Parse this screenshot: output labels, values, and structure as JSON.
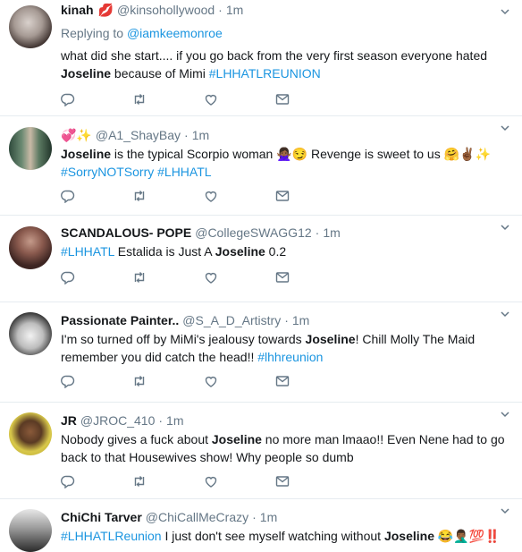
{
  "tweets": [
    {
      "name": "kinah",
      "name_emoji": "💋",
      "handle": "@kinsohollywood",
      "time": "1m",
      "replying_prefix": "Replying to ",
      "replying_to": "@iamkeemonroe",
      "text_parts": [
        {
          "t": "what did she start.... if you go back from the very first season everyone hated "
        },
        {
          "t": "Joseline",
          "b": true
        },
        {
          "t": " because of Mimi "
        },
        {
          "t": "#LHHATLREUNION",
          "tag": true
        }
      ]
    },
    {
      "name": "",
      "name_emoji": "💞✨",
      "handle": "@A1_ShayBay",
      "time": "1m",
      "text_parts": [
        {
          "t": "Joseline",
          "b": true
        },
        {
          "t": " is the typical Scorpio woman 🙅🏾‍♀️😏 Revenge is sweet to us 🤗✌🏾✨"
        },
        {
          "br": true
        },
        {
          "t": "#SorryNOTSorry",
          "tag": true
        },
        {
          "t": " "
        },
        {
          "t": "#LHHATL",
          "tag": true
        }
      ]
    },
    {
      "name": "SCANDALOUS- POPE",
      "handle": "@CollegeSWAGG12",
      "time": "1m",
      "text_parts": [
        {
          "t": "#LHHATL",
          "tag": true
        },
        {
          "t": "  Estalida is Just A "
        },
        {
          "t": "Joseline",
          "b": true
        },
        {
          "t": " 0.2"
        }
      ]
    },
    {
      "name": "Passionate Painter..",
      "handle": "@S_A_D_Artistry",
      "time": "1m",
      "text_parts": [
        {
          "t": "I'm so turned off by MiMi's jealousy  towards "
        },
        {
          "t": "Joseline",
          "b": true
        },
        {
          "t": "! Chill Molly The Maid remember you did catch the head!! "
        },
        {
          "t": "#lhhreunion",
          "tag": true
        }
      ]
    },
    {
      "name": "JR",
      "handle": "@JROC_410",
      "time": "1m",
      "text_parts": [
        {
          "t": "Nobody gives a fuck about "
        },
        {
          "t": "Joseline",
          "b": true
        },
        {
          "t": " no more man lmaao!! Even Nene had to go back to that Housewives show! Why people so dumb"
        }
      ]
    },
    {
      "name": "ChiChi Tarver",
      "handle": "@ChiCallMeCrazy",
      "time": "1m",
      "text_parts": [
        {
          "t": "#LHHATLReunion",
          "tag": true
        },
        {
          "t": " I just don't see myself watching without "
        },
        {
          "t": "Joseline",
          "b": true
        },
        {
          "t": " 😂🤦🏾‍♂️💯‼️"
        }
      ]
    }
  ],
  "separator": "·",
  "icons": {
    "reply": "reply-icon",
    "retweet": "retweet-icon",
    "like": "like-icon",
    "message": "direct-message-icon",
    "caret": "chevron-down-icon"
  },
  "colors": {
    "link": "#1b95e0",
    "muted": "#657786",
    "border": "#e6ecf0"
  }
}
